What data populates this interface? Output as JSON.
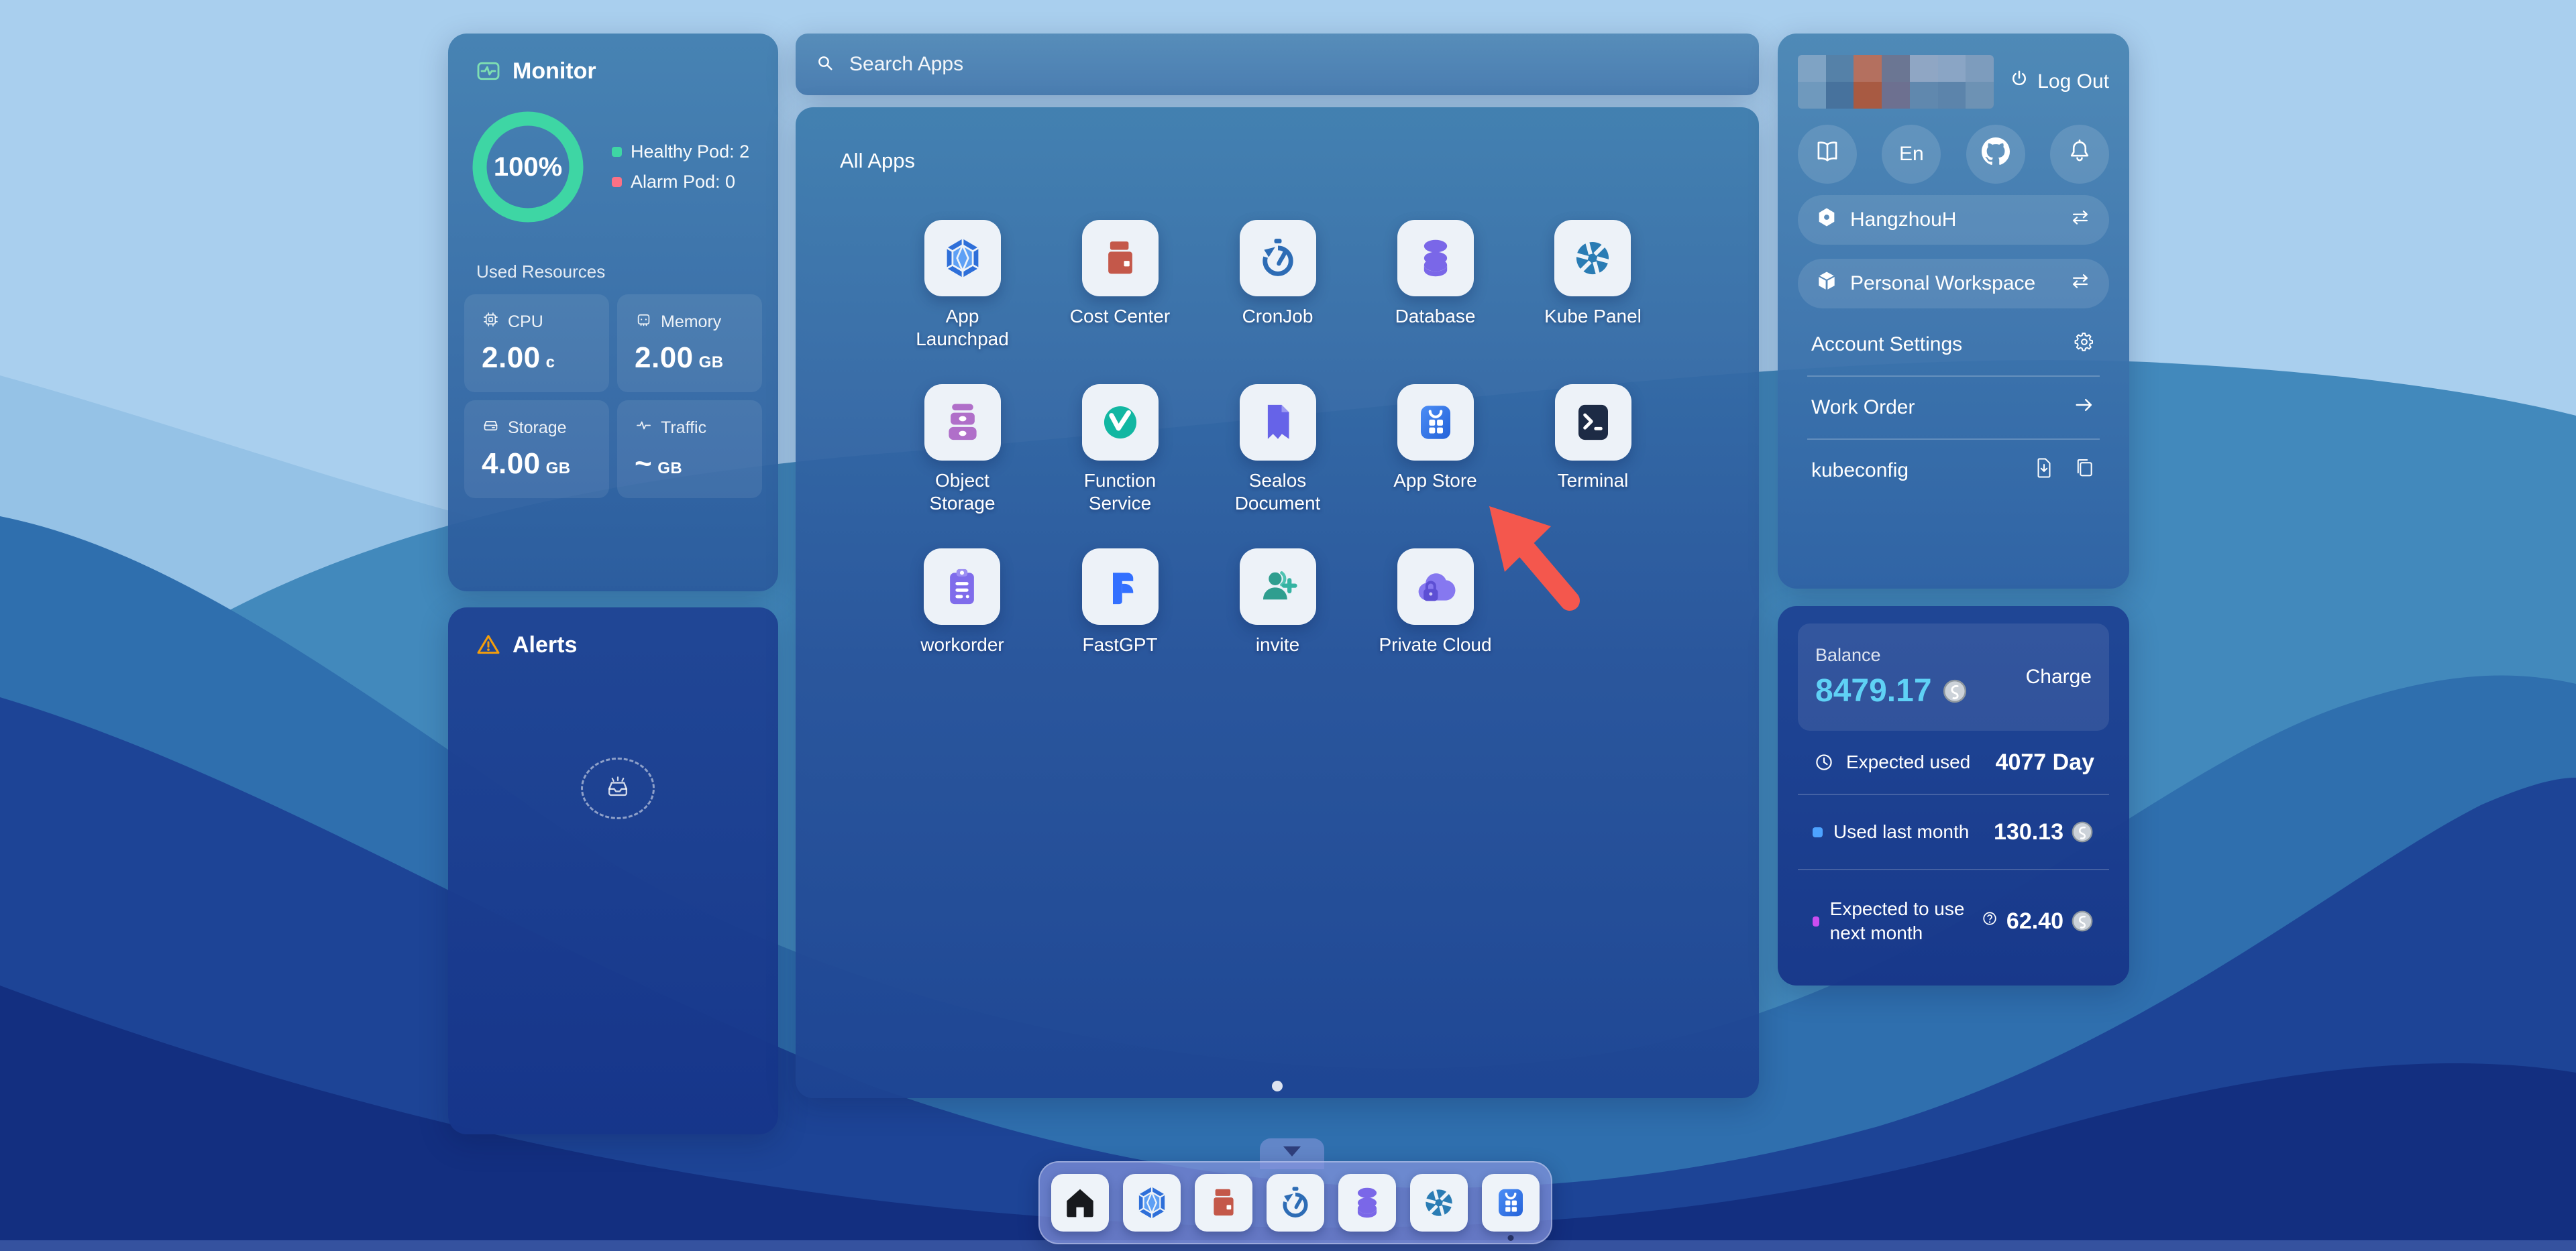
{
  "colors": {
    "accent_cyan": "#5fd1f5",
    "healthy_green": "#3ed6a4",
    "alarm_red": "#fb7185",
    "warning_orange": "#f59e0b",
    "arrow_red": "#f4574d",
    "used_dot_blue": "#4da3ff",
    "expected_dot_purple": "#cb4df0"
  },
  "monitor": {
    "title": "Monitor",
    "gauge_percent": "100%",
    "legend": [
      {
        "label": "Healthy Pod: 2",
        "color": "#3ed6a4"
      },
      {
        "label": "Alarm Pod: 0",
        "color": "#fb7185"
      }
    ],
    "used_resources_label": "Used Resources",
    "stats": [
      {
        "icon": "cpu-icon",
        "label": "CPU",
        "value": "2.00",
        "unit": "c"
      },
      {
        "icon": "memory-icon",
        "label": "Memory",
        "value": "2.00",
        "unit": "GB"
      },
      {
        "icon": "storage-icon",
        "label": "Storage",
        "value": "4.00",
        "unit": "GB"
      },
      {
        "icon": "traffic-icon",
        "label": "Traffic",
        "value": "~",
        "unit": "GB"
      }
    ]
  },
  "alerts": {
    "title": "Alerts"
  },
  "search": {
    "placeholder": "Search Apps"
  },
  "apps": {
    "title": "All Apps",
    "items": [
      {
        "label": "App Launchpad",
        "icon": "launchpad-icon"
      },
      {
        "label": "Cost Center",
        "icon": "cost-center-icon"
      },
      {
        "label": "CronJob",
        "icon": "cronjob-icon"
      },
      {
        "label": "Database",
        "icon": "database-icon"
      },
      {
        "label": "Kube Panel",
        "icon": "kube-panel-icon"
      },
      {
        "label": "Object Storage",
        "icon": "object-storage-icon"
      },
      {
        "label": "Function Service",
        "icon": "function-service-icon"
      },
      {
        "label": "Sealos Document",
        "icon": "sealos-document-icon"
      },
      {
        "label": "App Store",
        "icon": "app-store-icon"
      },
      {
        "label": "Terminal",
        "icon": "terminal-icon"
      },
      {
        "label": "workorder",
        "icon": "workorder-icon"
      },
      {
        "label": "FastGPT",
        "icon": "fastgpt-icon"
      },
      {
        "label": "invite",
        "icon": "invite-icon"
      },
      {
        "label": "Private Cloud",
        "icon": "private-cloud-icon"
      }
    ]
  },
  "user": {
    "logout_label": "Log Out",
    "language": "En",
    "region": "HangzhouH",
    "workspace": "Personal Workspace",
    "account_settings": "Account Settings",
    "work_order": "Work Order",
    "kubeconfig": "kubeconfig",
    "avatar_mosaic": [
      "#7fa3c4",
      "#5581a8",
      "#b4705f",
      "#6b7693",
      "#8fa6c4",
      "#8aa5c5",
      "#7d9cbd",
      "#6f99bd",
      "#47729d",
      "#a85a42",
      "#6d7090",
      "#6088ae",
      "#5c84ab",
      "#6d92b4"
    ]
  },
  "billing": {
    "balance_label": "Balance",
    "balance": "8479.17",
    "charge_label": "Charge",
    "rows": [
      {
        "icon": "clock-icon",
        "label": "Expected used",
        "value": "4077 Day"
      },
      {
        "dot": "#4da3ff",
        "label": "Used last month",
        "value": "130.13",
        "coin": true
      },
      {
        "dot": "#cb4df0",
        "label": "Expected to use next month",
        "value": "62.40",
        "coin": true,
        "help": true
      }
    ]
  },
  "dock": {
    "items": [
      {
        "name": "home",
        "icon": "home-icon"
      },
      {
        "name": "app-launchpad",
        "icon": "launchpad-icon"
      },
      {
        "name": "cost-center",
        "icon": "cost-center-icon"
      },
      {
        "name": "cronjob",
        "icon": "cronjob-icon"
      },
      {
        "name": "database",
        "icon": "database-icon"
      },
      {
        "name": "kube-panel",
        "icon": "kube-panel-icon"
      },
      {
        "name": "app-store",
        "icon": "app-store-icon",
        "active": true
      }
    ]
  }
}
